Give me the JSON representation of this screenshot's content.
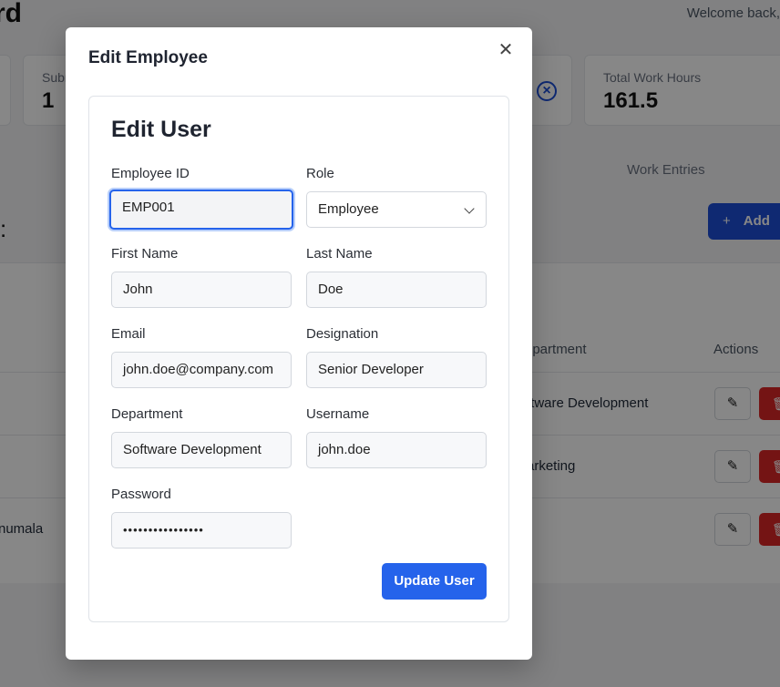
{
  "background": {
    "title_partial": "rd",
    "welcome": "Welcome back,",
    "stats": [
      {
        "label": "Subm",
        "value": "1"
      },
      {
        "label": "Total Work Hours",
        "value": "161.5"
      }
    ],
    "tabs": {
      "work_entries": "Work Entries"
    },
    "add_button": "Add",
    "table": {
      "headers": {
        "department": "epartment",
        "actions": "Actions"
      },
      "rows": [
        {
          "department": "ftware Development"
        },
        {
          "department": "arketing"
        },
        {
          "name_partial": "numala"
        }
      ]
    }
  },
  "modal": {
    "title": "Edit Employee",
    "close_icon": "close-icon",
    "form": {
      "heading": "Edit User",
      "fields": {
        "employee_id": {
          "label": "Employee ID",
          "value": "EMP001"
        },
        "role": {
          "label": "Role",
          "value": "Employee"
        },
        "first_name": {
          "label": "First Name",
          "value": "John"
        },
        "last_name": {
          "label": "Last Name",
          "value": "Doe"
        },
        "email": {
          "label": "Email",
          "value": "john.doe@company.com"
        },
        "designation": {
          "label": "Designation",
          "value": "Senior Developer"
        },
        "department": {
          "label": "Department",
          "value": "Software Development"
        },
        "username": {
          "label": "Username",
          "value": "john.doe"
        },
        "password": {
          "label": "Password",
          "value": "••••••••••••••••"
        }
      },
      "submit_label": "Update User"
    }
  },
  "colors": {
    "accent": "#2563eb",
    "danger": "#dc2626"
  }
}
